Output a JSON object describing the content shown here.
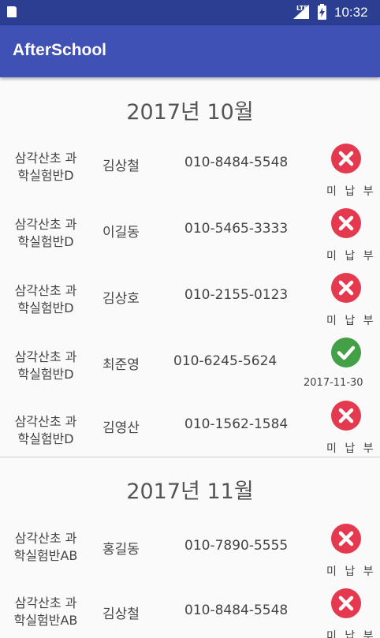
{
  "status_bar": {
    "network": "LTE",
    "time": "10:32"
  },
  "app_bar": {
    "title": "AfterSchool"
  },
  "colors": {
    "primary": "#3f51b5",
    "status_bar": "#2b3e91",
    "unpaid": "#e53950",
    "paid": "#43a047"
  },
  "sections": [
    {
      "month": "2017년 10월",
      "rows": [
        {
          "class_line1": "삼각산초 과",
          "class_line2": "학실험반D",
          "student": "김상철",
          "phone": "010-8484-5548",
          "status": "unpaid",
          "status_icon": "cancel-icon",
          "status_text": "미 납 부"
        },
        {
          "class_line1": "삼각산초 과",
          "class_line2": "학실험반D",
          "student": "이길동",
          "phone": "010-5465-3333",
          "status": "unpaid",
          "status_icon": "cancel-icon",
          "status_text": "미 납 부"
        },
        {
          "class_line1": "삼각산초 과",
          "class_line2": "학실험반D",
          "student": "김상호",
          "phone": "010-2155-0123",
          "status": "unpaid",
          "status_icon": "cancel-icon",
          "status_text": "미 납 부"
        },
        {
          "class_line1": "삼각산초 과",
          "class_line2": "학실험반D",
          "student": "최준영",
          "phone": "010-6245-5624",
          "status": "paid",
          "status_icon": "check-icon",
          "status_text": "2017-11-30"
        },
        {
          "class_line1": "삼각산초 과",
          "class_line2": "학실험반D",
          "student": "김영산",
          "phone": "010-1562-1584",
          "status": "unpaid",
          "status_icon": "cancel-icon",
          "status_text": "미 납 부"
        }
      ]
    },
    {
      "month": "2017년 11월",
      "rows": [
        {
          "class_line1": "삼각산초 과",
          "class_line2": "학실험반AB",
          "student": "홍길동",
          "phone": "010-7890-5555",
          "status": "unpaid",
          "status_icon": "cancel-icon",
          "status_text": "미 납 부"
        },
        {
          "class_line1": "삼각산초 과",
          "class_line2": "학실험반AB",
          "student": "김상철",
          "phone": "010-8484-5548",
          "status": "unpaid",
          "status_icon": "cancel-icon",
          "status_text": "미 납 부"
        }
      ]
    }
  ]
}
